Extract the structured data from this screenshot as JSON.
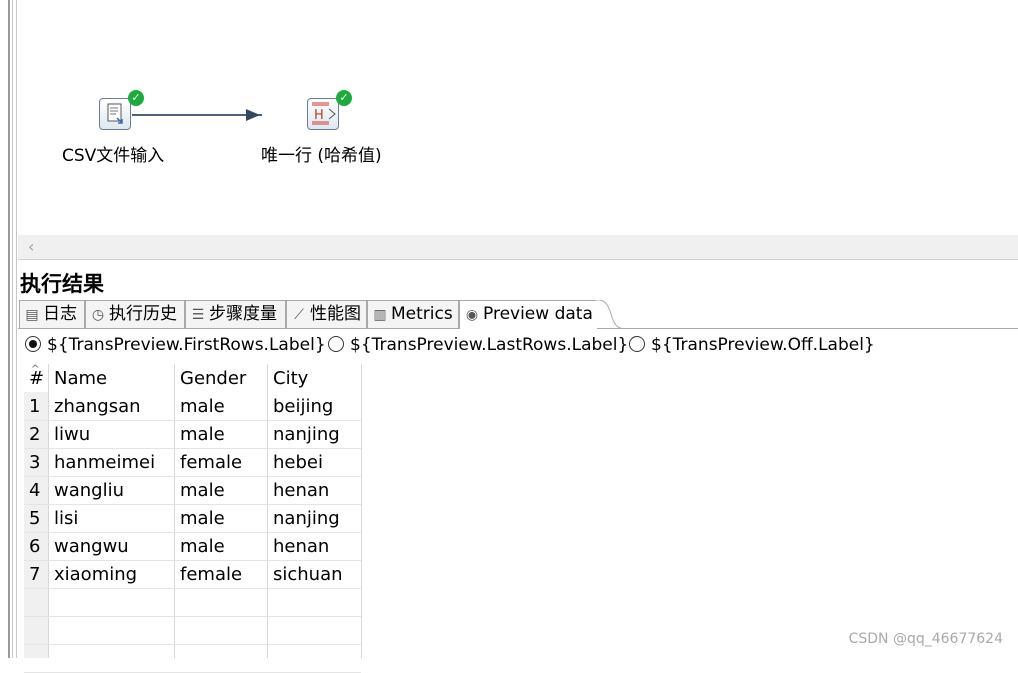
{
  "canvas": {
    "steps": [
      {
        "label": "CSV文件输入",
        "icon": "csv-file-input-icon",
        "status": "ok"
      },
      {
        "label": "唯一行 (哈希值)",
        "icon": "unique-rows-hash-icon",
        "status": "ok"
      }
    ]
  },
  "results": {
    "title": "执行结果",
    "tabs": [
      {
        "label": "日志",
        "icon": "log-icon"
      },
      {
        "label": "执行历史",
        "icon": "history-icon"
      },
      {
        "label": "步骤度量",
        "icon": "step-metrics-icon"
      },
      {
        "label": "性能图",
        "icon": "performance-graph-icon"
      },
      {
        "label": "Metrics",
        "icon": "metrics-icon"
      },
      {
        "label": "Preview data",
        "icon": "preview-eye-icon",
        "active": true
      }
    ],
    "preview_options": [
      {
        "label": "${TransPreview.FirstRows.Label}",
        "selected": true
      },
      {
        "label": "${TransPreview.LastRows.Label}",
        "selected": false
      },
      {
        "label": "${TransPreview.Off.Label}",
        "selected": false
      }
    ],
    "table": {
      "columns": [
        "#",
        "Name",
        "Gender",
        "City"
      ],
      "rows": [
        [
          "1",
          "zhangsan",
          "male",
          "beijing"
        ],
        [
          "2",
          "liwu",
          "male",
          "nanjing"
        ],
        [
          "3",
          "hanmeimei",
          "female",
          "hebei"
        ],
        [
          "4",
          "wangliu",
          "male",
          "henan"
        ],
        [
          "5",
          "lisi",
          "male",
          "nanjing"
        ],
        [
          "6",
          "wangwu",
          "male",
          "henan"
        ],
        [
          "7",
          "xiaoming",
          "female",
          "sichuan"
        ]
      ]
    }
  },
  "watermark": "CSDN @qq_46677624",
  "colors": {
    "ok_badge": "#1faa3c",
    "hop": "#4c6180"
  }
}
